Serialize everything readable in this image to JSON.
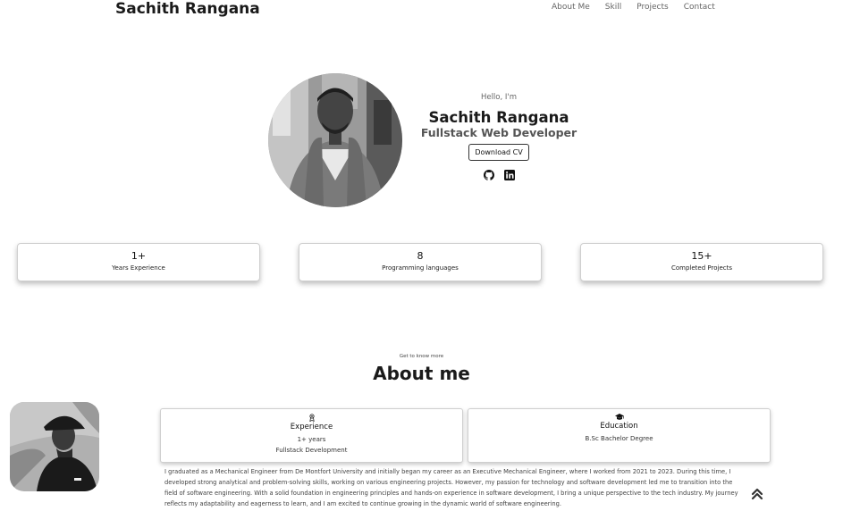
{
  "header": {
    "brand": "Sachith Rangana",
    "nav": [
      "About Me",
      "Skill",
      "Projects",
      "Contact"
    ]
  },
  "hero": {
    "greeting": "Hello, I'm",
    "name": "Sachith Rangana",
    "role": "Fullstack Web Developer",
    "cv_button": "Download CV",
    "socials": [
      "github-icon",
      "linkedin-icon"
    ]
  },
  "stats": [
    {
      "value": "1+",
      "label": "Years Experience"
    },
    {
      "value": "8",
      "label": "Programming languages"
    },
    {
      "value": "15+",
      "label": "Completed Projects"
    }
  ],
  "about": {
    "eyebrow": "Get to know more",
    "title": "About me",
    "cards": [
      {
        "title": "Experience",
        "lines": [
          "1+ years",
          "Fullstack Development"
        ],
        "icon": "award-icon"
      },
      {
        "title": "Education",
        "lines": [
          "B.Sc Bachelor Degree"
        ],
        "icon": "graduation-cap-icon"
      }
    ],
    "bio": "I graduated as a Mechanical Engineer from De Montfort University and initially began my career as an Executive Mechanical Engineer, where I worked from 2021 to 2023. During this time, I developed strong analytical and problem-solving skills, working on various engineering projects. However, my passion for technology and software development led me to transition into the field of software engineering. With a solid foundation in engineering principles and hands-on experience in software development, I bring a unique perspective to the tech industry. My journey reflects my adaptability and eagerness to learn, and I am excited to continue growing in the dynamic world of software engineering."
  },
  "colors": {
    "text": "#1a1a1a",
    "muted": "#666666",
    "card_border": "#cfcfcf"
  }
}
